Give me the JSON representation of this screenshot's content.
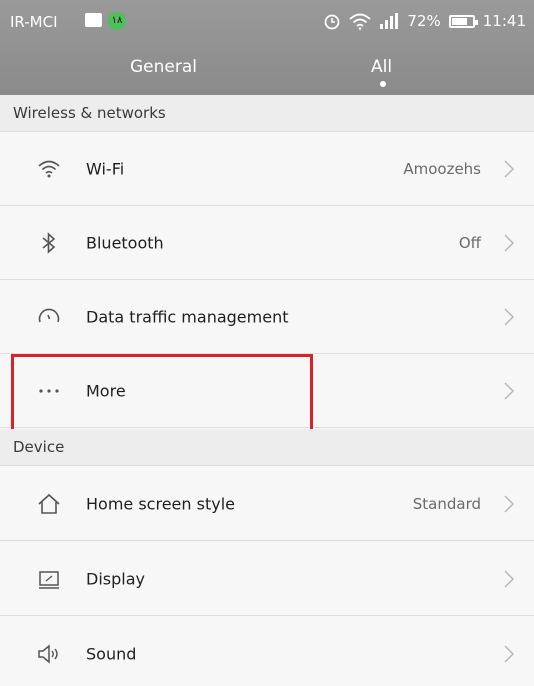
{
  "status_bar": {
    "carrier": "IR-MCI",
    "badge": "١٨",
    "battery": "72%",
    "time": "11:41"
  },
  "tabs": [
    {
      "label": "General"
    },
    {
      "label": "All"
    }
  ],
  "sections": {
    "wireless_header": "Wireless & networks",
    "device_header": "Device"
  },
  "rows": {
    "wifi": {
      "label": "Wi-Fi",
      "value": "Amoozehs",
      "icon": "wifi-icon"
    },
    "bluetooth": {
      "label": "Bluetooth",
      "value": "Off",
      "icon": "bluetooth-icon"
    },
    "data": {
      "label": "Data traffic management",
      "icon": "data-gauge-icon"
    },
    "more": {
      "label": "More",
      "icon": "more-dots-icon"
    },
    "home": {
      "label": "Home screen style",
      "value": "Standard",
      "icon": "home-icon"
    },
    "display": {
      "label": "Display",
      "icon": "display-icon"
    },
    "sound": {
      "label": "Sound",
      "icon": "sound-icon"
    }
  },
  "colors": {
    "header_bg": "#8f8f8f",
    "highlight": "#d9212a"
  }
}
